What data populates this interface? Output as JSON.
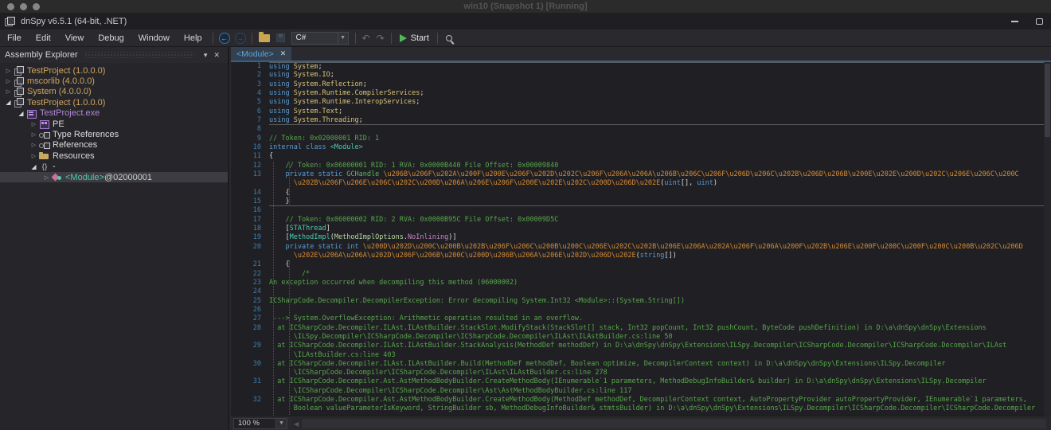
{
  "vm_titlebar": {
    "title": "win10 (Snapshot 1) [Running]"
  },
  "app": {
    "title": "dnSpy v6.5.1 (64-bit, .NET)",
    "window_buttons": {
      "minimize": "minimize",
      "maximize": "maximize"
    }
  },
  "menu": {
    "items": [
      "File",
      "Edit",
      "View",
      "Debug",
      "Window",
      "Help"
    ]
  },
  "toolbar": {
    "language_selector": "C#",
    "start_label": "Start",
    "icons": [
      "back",
      "forward",
      "open-file",
      "save",
      "undo",
      "redo",
      "start-debugging",
      "search"
    ]
  },
  "assembly_explorer": {
    "title": "Assembly Explorer",
    "items": [
      {
        "indent": 0,
        "exp": "c",
        "icon": "assembly",
        "parts": [
          {
            "t": "TestProject (1.0.0.0)",
            "c": "asm"
          }
        ]
      },
      {
        "indent": 0,
        "exp": "c",
        "icon": "assembly",
        "parts": [
          {
            "t": "mscorlib (4.0.0.0)",
            "c": "asm"
          }
        ]
      },
      {
        "indent": 0,
        "exp": "c",
        "icon": "assembly",
        "parts": [
          {
            "t": "System (4.0.0.0)",
            "c": "asm"
          }
        ]
      },
      {
        "indent": 0,
        "exp": "e",
        "icon": "assembly",
        "parts": [
          {
            "t": "TestProject (1.0.0.0)",
            "c": "asm"
          }
        ]
      },
      {
        "indent": 1,
        "exp": "e",
        "icon": "module",
        "parts": [
          {
            "t": "TestProject.exe",
            "c": "mod"
          }
        ]
      },
      {
        "indent": 2,
        "exp": "c",
        "icon": "pe",
        "parts": [
          {
            "t": "PE",
            "c": "plain"
          }
        ]
      },
      {
        "indent": 2,
        "exp": "c",
        "icon": "typeref",
        "parts": [
          {
            "t": "Type References",
            "c": "plain"
          }
        ]
      },
      {
        "indent": 2,
        "exp": "c",
        "icon": "typeref",
        "parts": [
          {
            "t": "References",
            "c": "plain"
          }
        ]
      },
      {
        "indent": 2,
        "exp": "c",
        "icon": "folder",
        "parts": [
          {
            "t": "Resources",
            "c": "plain"
          }
        ]
      },
      {
        "indent": 2,
        "exp": "e",
        "icon": "braces",
        "parts": [
          {
            "t": "-",
            "c": "plain"
          }
        ]
      },
      {
        "indent": 3,
        "exp": "c",
        "icon": "moduleclass",
        "selected": true,
        "parts": [
          {
            "t": "<Module>",
            "c": "type"
          },
          {
            "t": " @02000001",
            "c": "addr"
          }
        ]
      }
    ]
  },
  "editor": {
    "tab": {
      "label": "<Module>",
      "close": "x"
    },
    "zoom_level": "100 %",
    "lines": [
      {
        "num": "1",
        "septop": true,
        "segs": [
          [
            "k",
            "using"
          ],
          [
            "p",
            " "
          ],
          [
            "n",
            "System"
          ],
          [
            "p",
            ";"
          ]
        ]
      },
      {
        "num": "2",
        "segs": [
          [
            "k",
            "using"
          ],
          [
            "p",
            " "
          ],
          [
            "n",
            "System.IO"
          ],
          [
            "p",
            ";"
          ]
        ]
      },
      {
        "num": "3",
        "segs": [
          [
            "k",
            "using"
          ],
          [
            "p",
            " "
          ],
          [
            "n",
            "System.Reflection"
          ],
          [
            "p",
            ";"
          ]
        ]
      },
      {
        "num": "4",
        "segs": [
          [
            "k",
            "using"
          ],
          [
            "p",
            " "
          ],
          [
            "n",
            "System.Runtime.CompilerServices"
          ],
          [
            "p",
            ";"
          ]
        ]
      },
      {
        "num": "5",
        "segs": [
          [
            "k",
            "using"
          ],
          [
            "p",
            " "
          ],
          [
            "n",
            "System.Runtime.InteropServices"
          ],
          [
            "p",
            ";"
          ]
        ]
      },
      {
        "num": "6",
        "segs": [
          [
            "k",
            "using"
          ],
          [
            "p",
            " "
          ],
          [
            "n",
            "System.Text"
          ],
          [
            "p",
            ";"
          ]
        ]
      },
      {
        "num": "7",
        "sepbot": true,
        "segs": [
          [
            "k",
            "using"
          ],
          [
            "p",
            " "
          ],
          [
            "n",
            "System.Threading"
          ],
          [
            "p",
            ";"
          ]
        ]
      },
      {
        "num": "8",
        "segs": []
      },
      {
        "num": "9",
        "segs": [
          [
            "c",
            "// Token: 0x02000001 RID: 1"
          ]
        ]
      },
      {
        "num": "10",
        "segs": [
          [
            "k",
            "internal"
          ],
          [
            "p",
            " "
          ],
          [
            "k",
            "class"
          ],
          [
            "p",
            " "
          ],
          [
            "t",
            "<Module>"
          ]
        ]
      },
      {
        "num": "11",
        "segs": [
          [
            "p",
            "{"
          ]
        ]
      },
      {
        "num": "12",
        "segs": [
          [
            "c",
            "    // Token: 0x06000001 RID: 1 RVA: 0x0000B440 File Offset: 0x00009840"
          ]
        ]
      },
      {
        "num": "13",
        "segs": [
          [
            "p",
            "    "
          ],
          [
            "k",
            "private"
          ],
          [
            "p",
            " "
          ],
          [
            "k",
            "static"
          ],
          [
            "p",
            " "
          ],
          [
            "vt",
            "GCHandle"
          ],
          [
            "p",
            " "
          ],
          [
            "f",
            "\\u206B\\u206F\\u202A\\u200F\\u200E\\u206F\\u202D\\u202C\\u206F\\u206A\\u206A\\u206B\\u206C\\u206F\\u206D\\u206C\\u202B\\u206D\\u206B\\u200E\\u202E\\u200D\\u202C\\u206E\\u206C\\u200C"
          ]
        ]
      },
      {
        "num": "",
        "segs": [
          [
            "p",
            "      "
          ],
          [
            "f",
            "\\u202B\\u206F\\u206E\\u206C\\u202C\\u200D\\u206A\\u206E\\u206F\\u200E\\u202E\\u202C\\u200D\\u206D\\u202E"
          ],
          [
            "p",
            "("
          ],
          [
            "k",
            "uint"
          ],
          [
            "p",
            "[], "
          ],
          [
            "k",
            "uint"
          ],
          [
            "p",
            ")"
          ]
        ]
      },
      {
        "num": "14",
        "segs": [
          [
            "p",
            "    {"
          ]
        ]
      },
      {
        "num": "15",
        "sepbot": true,
        "segs": [
          [
            "p",
            "    }"
          ]
        ]
      },
      {
        "num": "16",
        "segs": []
      },
      {
        "num": "17",
        "segs": [
          [
            "c",
            "    // Token: 0x06000002 RID: 2 RVA: 0x0000B95C File Offset: 0x00009D5C"
          ]
        ]
      },
      {
        "num": "18",
        "segs": [
          [
            "p",
            "    ["
          ],
          [
            "t",
            "STAThread"
          ],
          [
            "p",
            "]"
          ]
        ]
      },
      {
        "num": "19",
        "segs": [
          [
            "p",
            "    ["
          ],
          [
            "t",
            "MethodImpl"
          ],
          [
            "p",
            "("
          ],
          [
            "en",
            "MethodImplOptions"
          ],
          [
            "p",
            "."
          ],
          [
            "ef",
            "NoInlining"
          ],
          [
            "p",
            ")]"
          ]
        ]
      },
      {
        "num": "20",
        "segs": [
          [
            "p",
            "    "
          ],
          [
            "k",
            "private"
          ],
          [
            "p",
            " "
          ],
          [
            "k",
            "static"
          ],
          [
            "p",
            " "
          ],
          [
            "k",
            "int"
          ],
          [
            "p",
            " "
          ],
          [
            "f",
            "\\u200D\\u202D\\u200C\\u200B\\u202B\\u206F\\u206C\\u200B\\u200C\\u206E\\u202C\\u202B\\u206E\\u206A\\u202A\\u206F\\u206A\\u200F\\u202B\\u206E\\u200F\\u200C\\u200F\\u200C\\u200B\\u202C\\u206D"
          ]
        ]
      },
      {
        "num": "",
        "segs": [
          [
            "p",
            "      "
          ],
          [
            "f",
            "\\u202E\\u206A\\u206A\\u202D\\u206F\\u206B\\u200C\\u200D\\u206B\\u206A\\u206E\\u202D\\u206D\\u202E"
          ],
          [
            "p",
            "("
          ],
          [
            "k",
            "string"
          ],
          [
            "p",
            "[])"
          ]
        ]
      },
      {
        "num": "21",
        "segs": [
          [
            "p",
            "    {"
          ]
        ]
      },
      {
        "num": "22",
        "segs": [
          [
            "c",
            "        /*"
          ]
        ]
      },
      {
        "num": "23",
        "segs": [
          [
            "c",
            "An exception occurred when decompiling this method (06000002)"
          ]
        ]
      },
      {
        "num": "24",
        "segs": []
      },
      {
        "num": "25",
        "segs": [
          [
            "c",
            "ICSharpCode.Decompiler.DecompilerException: Error decompiling System.Int32 <Module>::(System.String[])"
          ]
        ]
      },
      {
        "num": "26",
        "segs": []
      },
      {
        "num": "27",
        "segs": [
          [
            "c",
            " ---> System.OverflowException: Arithmetic operation resulted in an overflow."
          ]
        ]
      },
      {
        "num": "28",
        "segs": [
          [
            "c",
            "  at ICSharpCode.Decompiler.ILAst.ILAstBuilder.StackSlot.ModifyStack(StackSlot[] stack, Int32 popCount, Int32 pushCount, ByteCode pushDefinition) in D:\\a\\dnSpy\\dnSpy\\Extensions"
          ]
        ]
      },
      {
        "num": "",
        "segs": [
          [
            "c",
            "      \\ILSpy.Decompiler\\ICSharpCode.Decompiler\\ICSharpCode.Decompiler\\ILAst\\ILAstBuilder.cs:line 50"
          ]
        ]
      },
      {
        "num": "29",
        "segs": [
          [
            "c",
            "  at ICSharpCode.Decompiler.ILAst.ILAstBuilder.StackAnalysis(MethodDef methodDef) in D:\\a\\dnSpy\\dnSpy\\Extensions\\ILSpy.Decompiler\\ICSharpCode.Decompiler\\ICSharpCode.Decompiler\\ILAst"
          ]
        ]
      },
      {
        "num": "",
        "segs": [
          [
            "c",
            "      \\ILAstBuilder.cs:line 403"
          ]
        ]
      },
      {
        "num": "30",
        "segs": [
          [
            "c",
            "  at ICSharpCode.Decompiler.ILAst.ILAstBuilder.Build(MethodDef methodDef, Boolean optimize, DecompilerContext context) in D:\\a\\dnSpy\\dnSpy\\Extensions\\ILSpy.Decompiler"
          ]
        ]
      },
      {
        "num": "",
        "segs": [
          [
            "c",
            "      \\ICSharpCode.Decompiler\\ICSharpCode.Decompiler\\ILAst\\ILAstBuilder.cs:line 278"
          ]
        ]
      },
      {
        "num": "31",
        "segs": [
          [
            "c",
            "  at ICSharpCode.Decompiler.Ast.AstMethodBodyBuilder.CreateMethodBody(IEnumerable`1 parameters, MethodDebugInfoBuilder& builder) in D:\\a\\dnSpy\\dnSpy\\Extensions\\ILSpy.Decompiler"
          ]
        ]
      },
      {
        "num": "",
        "segs": [
          [
            "c",
            "      \\ICSharpCode.Decompiler\\ICSharpCode.Decompiler\\Ast\\AstMethodBodyBuilder.cs:line 117"
          ]
        ]
      },
      {
        "num": "32",
        "segs": [
          [
            "c",
            "  at ICSharpCode.Decompiler.Ast.AstMethodBodyBuilder.CreateMethodBody(MethodDef methodDef, DecompilerContext context, AutoPropertyProvider autoPropertyProvider, IEnumerable`1 parameters,"
          ]
        ]
      },
      {
        "num": "",
        "segs": [
          [
            "c",
            "      Boolean valueParameterIsKeyword, StringBuilder sb, MethodDebugInfoBuilder& stmtsBuilder) in D:\\a\\dnSpy\\dnSpy\\Extensions\\ILSpy.Decompiler\\ICSharpCode.Decompiler\\ICSharpCode.Decompiler"
          ]
        ]
      }
    ]
  },
  "colors": {
    "keyword": "#569cd6",
    "namespace": "#d9c279",
    "comment": "#57a64a",
    "type": "#4ec9b0",
    "valuetype": "#5bb75b",
    "enum": "#b8d7a3",
    "enum_field": "#c586c0",
    "obfuscated_name": "#d78a32",
    "line_number": "#3e7dad",
    "assembly_node": "#cfa45e",
    "module_node": "#b286d6",
    "tab_accent": "#33618d"
  }
}
